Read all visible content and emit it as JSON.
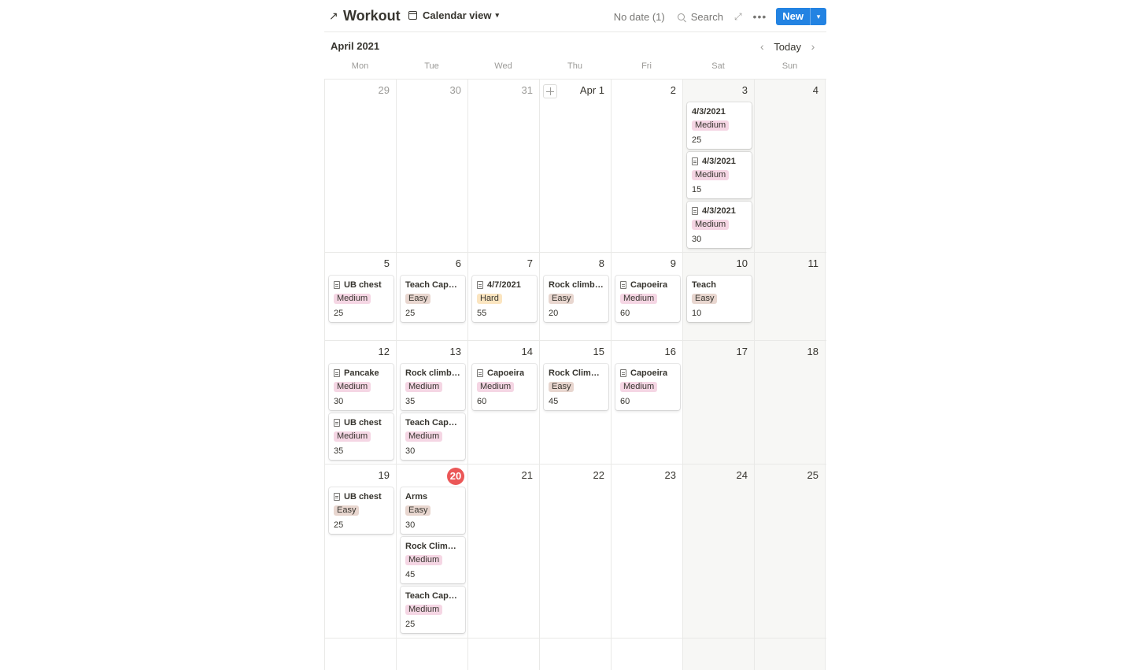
{
  "header": {
    "title": "Workout",
    "view_label": "Calendar view",
    "no_date": "No date (1)",
    "search_label": "Search",
    "new_label": "New"
  },
  "month_label": "April 2021",
  "nav": {
    "today_label": "Today"
  },
  "weekdays": [
    "Mon",
    "Tue",
    "Wed",
    "Thu",
    "Fri",
    "Sat",
    "Sun"
  ],
  "weeks": [
    {
      "days": [
        {
          "num": "29",
          "faded": true,
          "cards": []
        },
        {
          "num": "30",
          "faded": true,
          "cards": []
        },
        {
          "num": "31",
          "faded": true,
          "cards": []
        },
        {
          "num": "Apr 1",
          "add_button": true,
          "cards": []
        },
        {
          "num": "2",
          "cards": []
        },
        {
          "num": "3",
          "weekend": true,
          "cards": [
            {
              "title": "4/3/2021",
              "icon": false,
              "tag": "Medium",
              "value": "25"
            },
            {
              "title": "4/3/2021",
              "icon": true,
              "tag": "Medium",
              "value": "15"
            },
            {
              "title": "4/3/2021",
              "icon": true,
              "tag": "Medium",
              "value": "30"
            }
          ]
        },
        {
          "num": "4",
          "weekend": true,
          "cards": []
        }
      ]
    },
    {
      "days": [
        {
          "num": "5",
          "cards": [
            {
              "title": "UB chest",
              "icon": true,
              "tag": "Medium",
              "value": "25"
            }
          ]
        },
        {
          "num": "6",
          "cards": [
            {
              "title": "Teach Capoeira",
              "icon": false,
              "tag": "Easy",
              "value": "25"
            }
          ]
        },
        {
          "num": "7",
          "cards": [
            {
              "title": "4/7/2021",
              "icon": true,
              "tag": "Hard",
              "value": "55"
            }
          ]
        },
        {
          "num": "8",
          "cards": [
            {
              "title": "Rock climbing",
              "icon": false,
              "tag": "Easy",
              "value": "20"
            }
          ]
        },
        {
          "num": "9",
          "cards": [
            {
              "title": "Capoeira",
              "icon": true,
              "tag": "Medium",
              "value": "60"
            }
          ]
        },
        {
          "num": "10",
          "weekend": true,
          "cards": [
            {
              "title": "Teach",
              "icon": false,
              "tag": "Easy",
              "value": "10"
            }
          ]
        },
        {
          "num": "11",
          "weekend": true,
          "cards": []
        }
      ]
    },
    {
      "days": [
        {
          "num": "12",
          "cards": [
            {
              "title": "Pancake",
              "icon": true,
              "tag": "Medium",
              "value": "30"
            },
            {
              "title": "UB chest",
              "icon": true,
              "tag": "Medium",
              "value": "35"
            }
          ]
        },
        {
          "num": "13",
          "cards": [
            {
              "title": "Rock climbing",
              "icon": false,
              "tag": "Medium",
              "value": "35"
            },
            {
              "title": "Teach Capoeira",
              "icon": false,
              "tag": "Medium",
              "value": "30"
            }
          ]
        },
        {
          "num": "14",
          "cards": [
            {
              "title": "Capoeira",
              "icon": true,
              "tag": "Medium",
              "value": "60"
            }
          ]
        },
        {
          "num": "15",
          "cards": [
            {
              "title": "Rock Climbing",
              "icon": false,
              "tag": "Easy",
              "value": "45"
            }
          ]
        },
        {
          "num": "16",
          "cards": [
            {
              "title": "Capoeira",
              "icon": true,
              "tag": "Medium",
              "value": "60"
            }
          ]
        },
        {
          "num": "17",
          "weekend": true,
          "cards": []
        },
        {
          "num": "18",
          "weekend": true,
          "cards": []
        }
      ]
    },
    {
      "days": [
        {
          "num": "19",
          "cards": [
            {
              "title": "UB chest",
              "icon": true,
              "tag": "Easy",
              "value": "25"
            }
          ]
        },
        {
          "num": "20",
          "today": true,
          "cards": [
            {
              "title": "Arms",
              "icon": false,
              "tag": "Easy",
              "value": "30"
            },
            {
              "title": "Rock Climbing",
              "icon": false,
              "tag": "Medium",
              "value": "45"
            },
            {
              "title": "Teach Capoeira",
              "icon": false,
              "tag": "Medium",
              "value": "25"
            }
          ]
        },
        {
          "num": "21",
          "cards": []
        },
        {
          "num": "22",
          "cards": []
        },
        {
          "num": "23",
          "cards": []
        },
        {
          "num": "24",
          "weekend": true,
          "cards": []
        },
        {
          "num": "25",
          "weekend": true,
          "cards": []
        }
      ]
    },
    {
      "days": [
        {
          "num": "",
          "cards": []
        },
        {
          "num": "",
          "cards": []
        },
        {
          "num": "",
          "cards": []
        },
        {
          "num": "",
          "cards": []
        },
        {
          "num": "",
          "cards": []
        },
        {
          "num": "",
          "weekend": true,
          "cards": []
        },
        {
          "num": "",
          "weekend": true,
          "cards": []
        }
      ]
    }
  ]
}
